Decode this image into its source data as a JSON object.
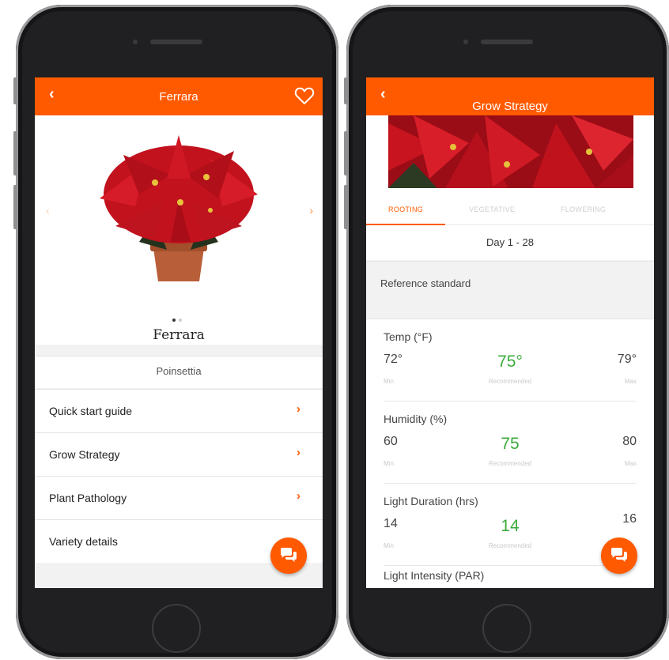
{
  "colors": {
    "accent": "#ff5a00",
    "recommended": "#3cab3c"
  },
  "phone1": {
    "nav": {
      "back": "‹",
      "title": "Ferrara"
    },
    "carousel": {
      "prev": "‹",
      "next": "›"
    },
    "variety_name": "Ferrara",
    "species": "Poinsettia",
    "menu": [
      {
        "label": "Quick start guide",
        "chevron": "›"
      },
      {
        "label": "Grow Strategy",
        "chevron": "›"
      },
      {
        "label": "Plant Pathology",
        "chevron": "›"
      },
      {
        "label": "Variety details"
      }
    ]
  },
  "phone2": {
    "nav": {
      "back": "‹",
      "title": "Grow Strategy"
    },
    "tabs": [
      "ROOTING",
      "VEGETATIVE",
      "FLOWERING"
    ],
    "day_range": "Day 1 - 28",
    "reference": "Reference standard",
    "metrics": [
      {
        "title": "Temp (°F)",
        "min": "72°",
        "recommended": "75°",
        "max": "79°",
        "min_label": "Min",
        "rec_label": "Recommended",
        "max_label": "Max"
      },
      {
        "title": "Humidity (%)",
        "min": "60",
        "recommended": "75",
        "max": "80",
        "min_label": "Min",
        "rec_label": "Recommended",
        "max_label": "Max"
      },
      {
        "title": "Light Duration (hrs)",
        "min": "14",
        "recommended": "14",
        "max": "16",
        "min_label": "Min",
        "rec_label": "Recommended",
        "max_label": ""
      },
      {
        "title": "Light Intensity (PAR)"
      }
    ]
  }
}
